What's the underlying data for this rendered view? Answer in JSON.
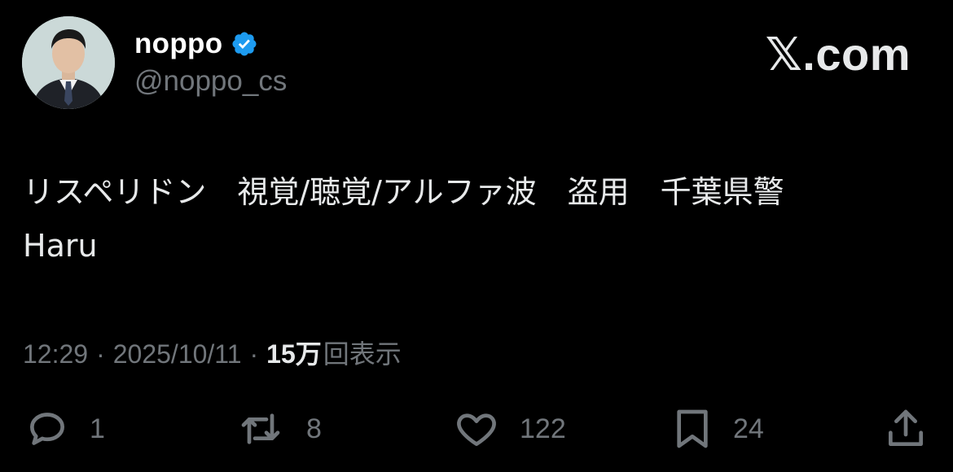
{
  "tweet": {
    "author": {
      "display_name": "noppo",
      "handle": "@noppo_cs",
      "verified": true,
      "avatar": "profile-photo"
    },
    "brand": "𝕏.com",
    "text_line1": "リスペリドン　視覚/聴覚/アルファ波　盗用　千葉県警",
    "text_line2": "Haru",
    "time": "12:29",
    "date": "2025/10/11",
    "separator": "·",
    "views_count": "15万",
    "views_label": "回表示"
  },
  "actions": {
    "reply": {
      "icon": "reply-icon",
      "count": "1"
    },
    "repost": {
      "icon": "repost-icon",
      "count": "8"
    },
    "like": {
      "icon": "heart-icon",
      "count": "122"
    },
    "bookmark": {
      "icon": "bookmark-icon",
      "count": "24"
    },
    "share": {
      "icon": "share-icon"
    }
  },
  "colors": {
    "background": "#000000",
    "primary_text": "#e7e9ea",
    "secondary_text": "#71767b",
    "verified_blue": "#1d9bf0"
  }
}
